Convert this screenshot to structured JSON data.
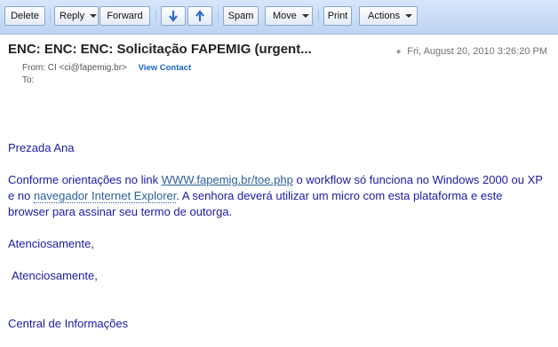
{
  "toolbar": {
    "delete": "Delete",
    "reply": "Reply",
    "forward": "Forward",
    "spam": "Spam",
    "move": "Move",
    "print": "Print",
    "actions": "Actions"
  },
  "message": {
    "subject": "ENC: ENC: ENC: Solicitação FAPEMIG (urgent...",
    "date": "Fri, August 20, 2010 3:26:20 PM",
    "from_label": "From:",
    "from_value": "CI <ci@fapemig.br>",
    "view_contact": "View Contact",
    "to_label": "To:"
  },
  "body": {
    "greeting": "Prezada Ana",
    "p1_a": "Conforme orientações no link ",
    "p1_link": "WWW.fapemig.br/toe.php",
    "p1_b": " o workflow só funciona no Windows 2000 ou XP e no ",
    "p1_link2": "navegador Internet Explorer",
    "p1_c": ". A senhora deverá utilizar um micro com esta plataforma e este browser para assinar seu termo de outorga.",
    "closing1": "Atenciosamente,",
    "closing2": "Atenciosamente,",
    "signature": "Central de Informações"
  }
}
